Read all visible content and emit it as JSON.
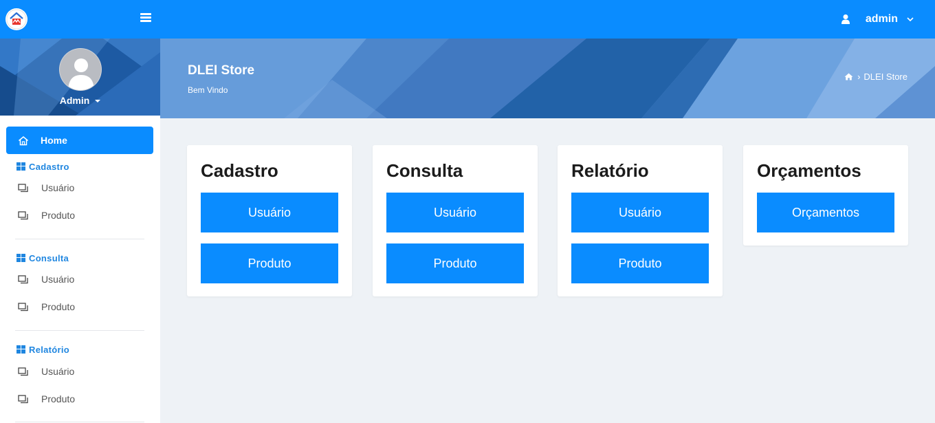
{
  "topbar": {
    "user_name": "admin"
  },
  "sidebar": {
    "profile_name": "Admin",
    "home_label": "Home",
    "sections": [
      {
        "title": "Cadastro",
        "items": [
          {
            "label": "Usuário"
          },
          {
            "label": "Produto"
          }
        ]
      },
      {
        "title": "Consulta",
        "items": [
          {
            "label": "Usuário"
          },
          {
            "label": "Produto"
          }
        ]
      },
      {
        "title": "Relatório",
        "items": [
          {
            "label": "Usuário"
          },
          {
            "label": "Produto"
          }
        ]
      }
    ]
  },
  "header": {
    "title": "DLEI Store",
    "subtitle": "Bem Vindo",
    "breadcrumb": "DLEI Store",
    "breadcrumb_sep": "›"
  },
  "cards": [
    {
      "title": "Cadastro",
      "buttons": [
        {
          "label": "Usuário"
        },
        {
          "label": "Produto"
        }
      ]
    },
    {
      "title": "Consulta",
      "buttons": [
        {
          "label": "Usuário"
        },
        {
          "label": "Produto"
        }
      ]
    },
    {
      "title": "Relatório",
      "buttons": [
        {
          "label": "Usuário"
        },
        {
          "label": "Produto"
        }
      ]
    },
    {
      "title": "Orçamentos",
      "buttons": [
        {
          "label": "Orçamentos"
        }
      ]
    }
  ],
  "colors": {
    "primary": "#0a8cff",
    "section_title": "#1f86e0",
    "background": "#eef2f6",
    "banner": "#5b92d4"
  },
  "icons": {
    "logo": "store-logo-icon",
    "menu": "hamburger-icon",
    "user": "user-icon",
    "dropdown": "chevron-down-icon",
    "home": "home-icon",
    "section": "grid-icon",
    "item": "window-icon",
    "breadcrumb_home": "home-icon"
  }
}
